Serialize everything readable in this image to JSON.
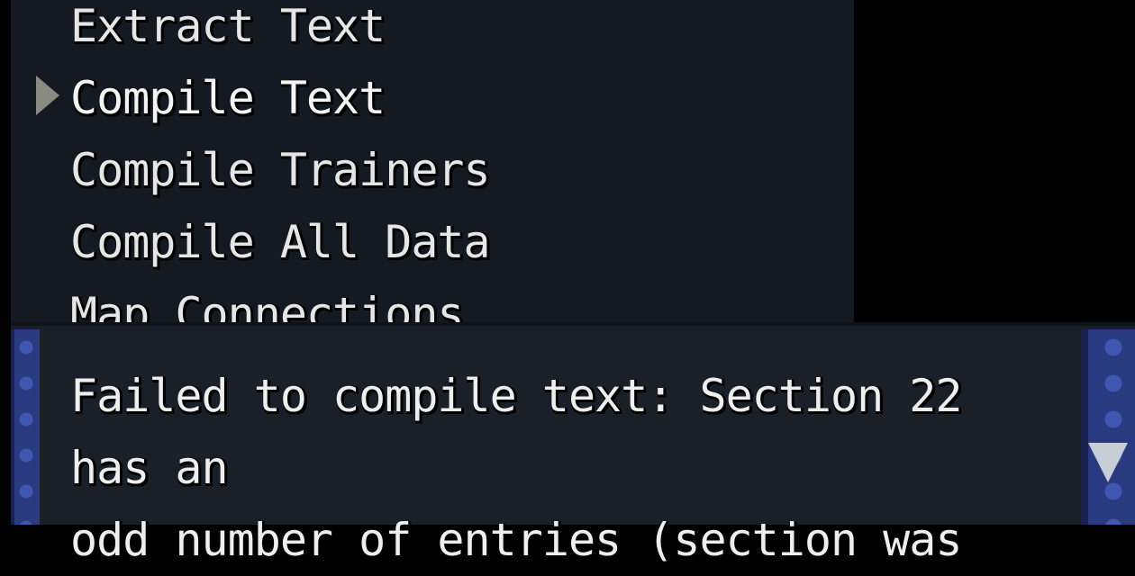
{
  "menu": {
    "items": [
      {
        "label": "Extract Text"
      },
      {
        "label": "Compile Text"
      },
      {
        "label": "Compile Trainers"
      },
      {
        "label": "Compile All Data"
      },
      {
        "label": "Map Connections"
      }
    ],
    "selected_index": 1
  },
  "message": {
    "line1": "Failed to compile text: Section 22 has an",
    "line2": "odd number of entries (section was"
  },
  "icons": {
    "cursor": "selection-arrow-icon",
    "more": "down-arrow-icon"
  },
  "colors": {
    "window_bg": "#151a22",
    "border": "#2a3a80",
    "text": "#e6e6e6"
  }
}
